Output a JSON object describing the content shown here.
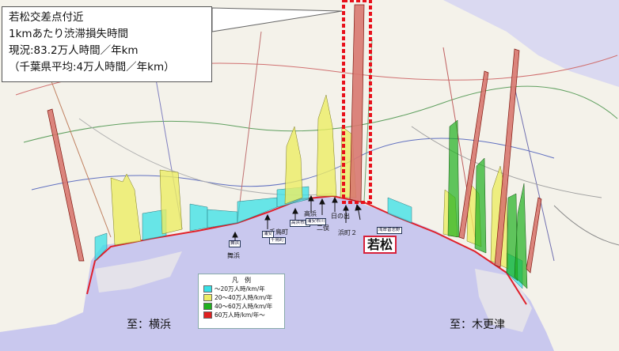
{
  "callout": {
    "line1": "若松交差点付近",
    "line2": "1kmあたり渋滞損失時間",
    "line3": "現況:83.2万人時間／年km",
    "line4": "（千葉県平均:4万人時間／年km）"
  },
  "legend": {
    "title": "凡　例",
    "items": [
      {
        "label": "～20万人時/km/年",
        "color": "#38e0e6"
      },
      {
        "label": "20～40万人時/km/年",
        "color": "#ecec64"
      },
      {
        "label": "40～60万人時/km/年",
        "color": "#20b020"
      },
      {
        "label": "60万人時/km/年～",
        "color": "#e02020"
      }
    ]
  },
  "destinations": {
    "left": "至：横浜",
    "right": "至：木更津"
  },
  "places": {
    "maihama": "舞浜",
    "chidoricho": "千鳥町",
    "takahama": "高浜",
    "hinode": "日の出",
    "futamata": "二俣",
    "hamacho2": "浜町２",
    "wakamatsu": "若松"
  },
  "road_tags": {
    "t1": "舞浜",
    "t2": "浦安",
    "t3": "千鳥町",
    "t4": "高浜市川",
    "t5": "浦安市川",
    "t6": "湾岸習志野"
  },
  "colors": {
    "sea": "#c9c8ee",
    "land": "#f4f2ea",
    "coast_line": "#e0202a",
    "highlight_box": "#e8101a"
  }
}
